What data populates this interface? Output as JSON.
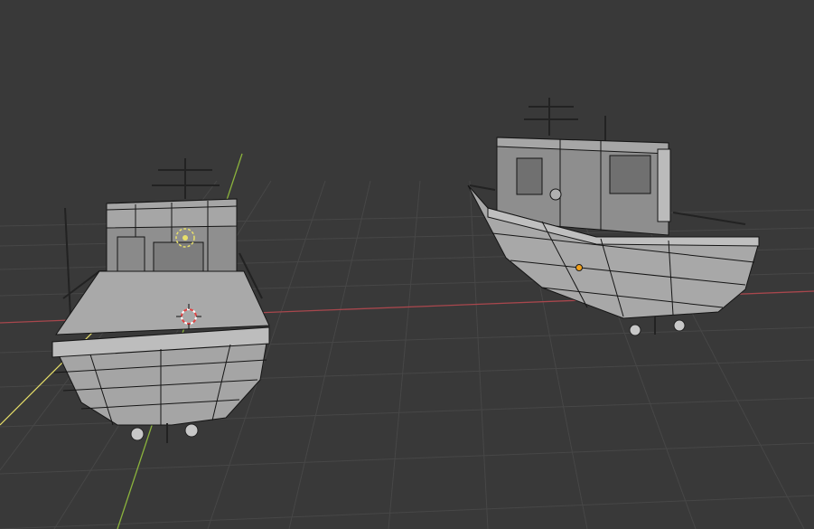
{
  "viewport": {
    "background": "#393939",
    "grid_color": "#4a4a4a",
    "x_axis_color": "#a8474d",
    "y_axis_color": "#8bb33d",
    "light_line_color": "#e8e06a",
    "selection_color": "#f2a11c"
  },
  "objects": [
    {
      "name": "boat-rear-view",
      "selected": false
    },
    {
      "name": "boat-three-quarter-view",
      "selected": false
    }
  ],
  "overlays": {
    "cursor_3d": "3d-cursor-icon",
    "light": "light-icon",
    "origin": "origin-dot-icon"
  }
}
